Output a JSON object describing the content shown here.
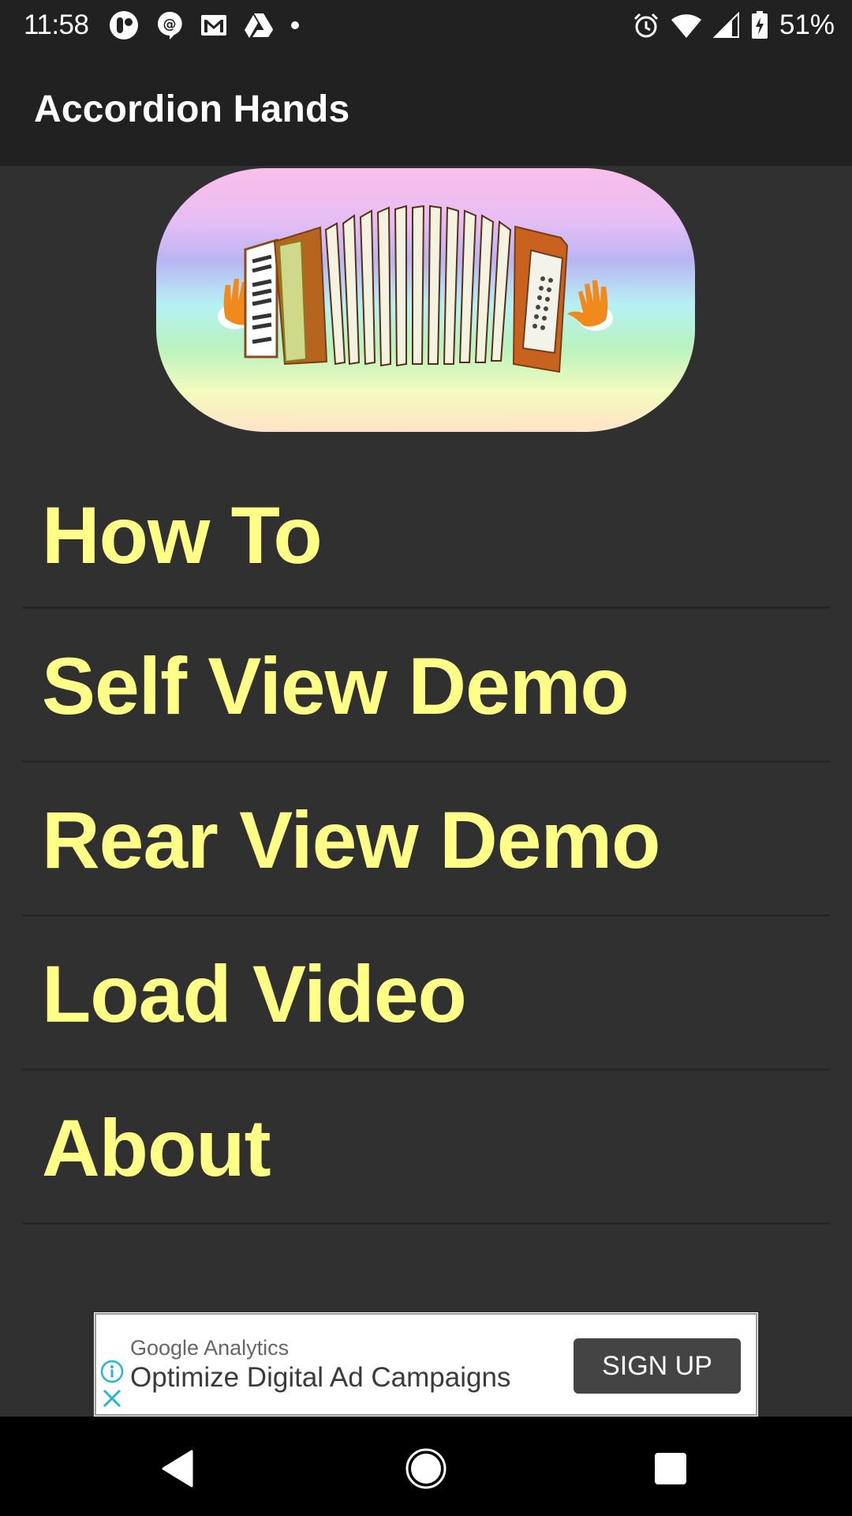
{
  "status_bar": {
    "time": "11:58",
    "left_icons": [
      "pocketcasts-icon",
      "chat-mention-icon",
      "gmail-icon",
      "drive-icon",
      "dot-icon"
    ],
    "right_icons": [
      "alarm-icon",
      "wifi-icon",
      "cell-signal-icon",
      "battery-charging-icon"
    ],
    "battery_percent": "51%"
  },
  "app_bar": {
    "title": "Accordion Hands"
  },
  "banner": {
    "image": "accordion-with-hands-illustration"
  },
  "menu": {
    "items": [
      {
        "label": "How To"
      },
      {
        "label": "Self View Demo"
      },
      {
        "label": "Rear View Demo"
      },
      {
        "label": "Load Video"
      },
      {
        "label": "About"
      }
    ]
  },
  "ad": {
    "sponsor": "Google Analytics",
    "headline": "Optimize Digital Ad Campaigns",
    "cta": "SIGN UP"
  },
  "nav_bar": {
    "buttons": [
      "back",
      "home",
      "recents"
    ]
  },
  "colors": {
    "menu_text": "#ffff88",
    "background": "#303030",
    "app_bar": "#212121",
    "ad_accent": "#29b6d6"
  }
}
